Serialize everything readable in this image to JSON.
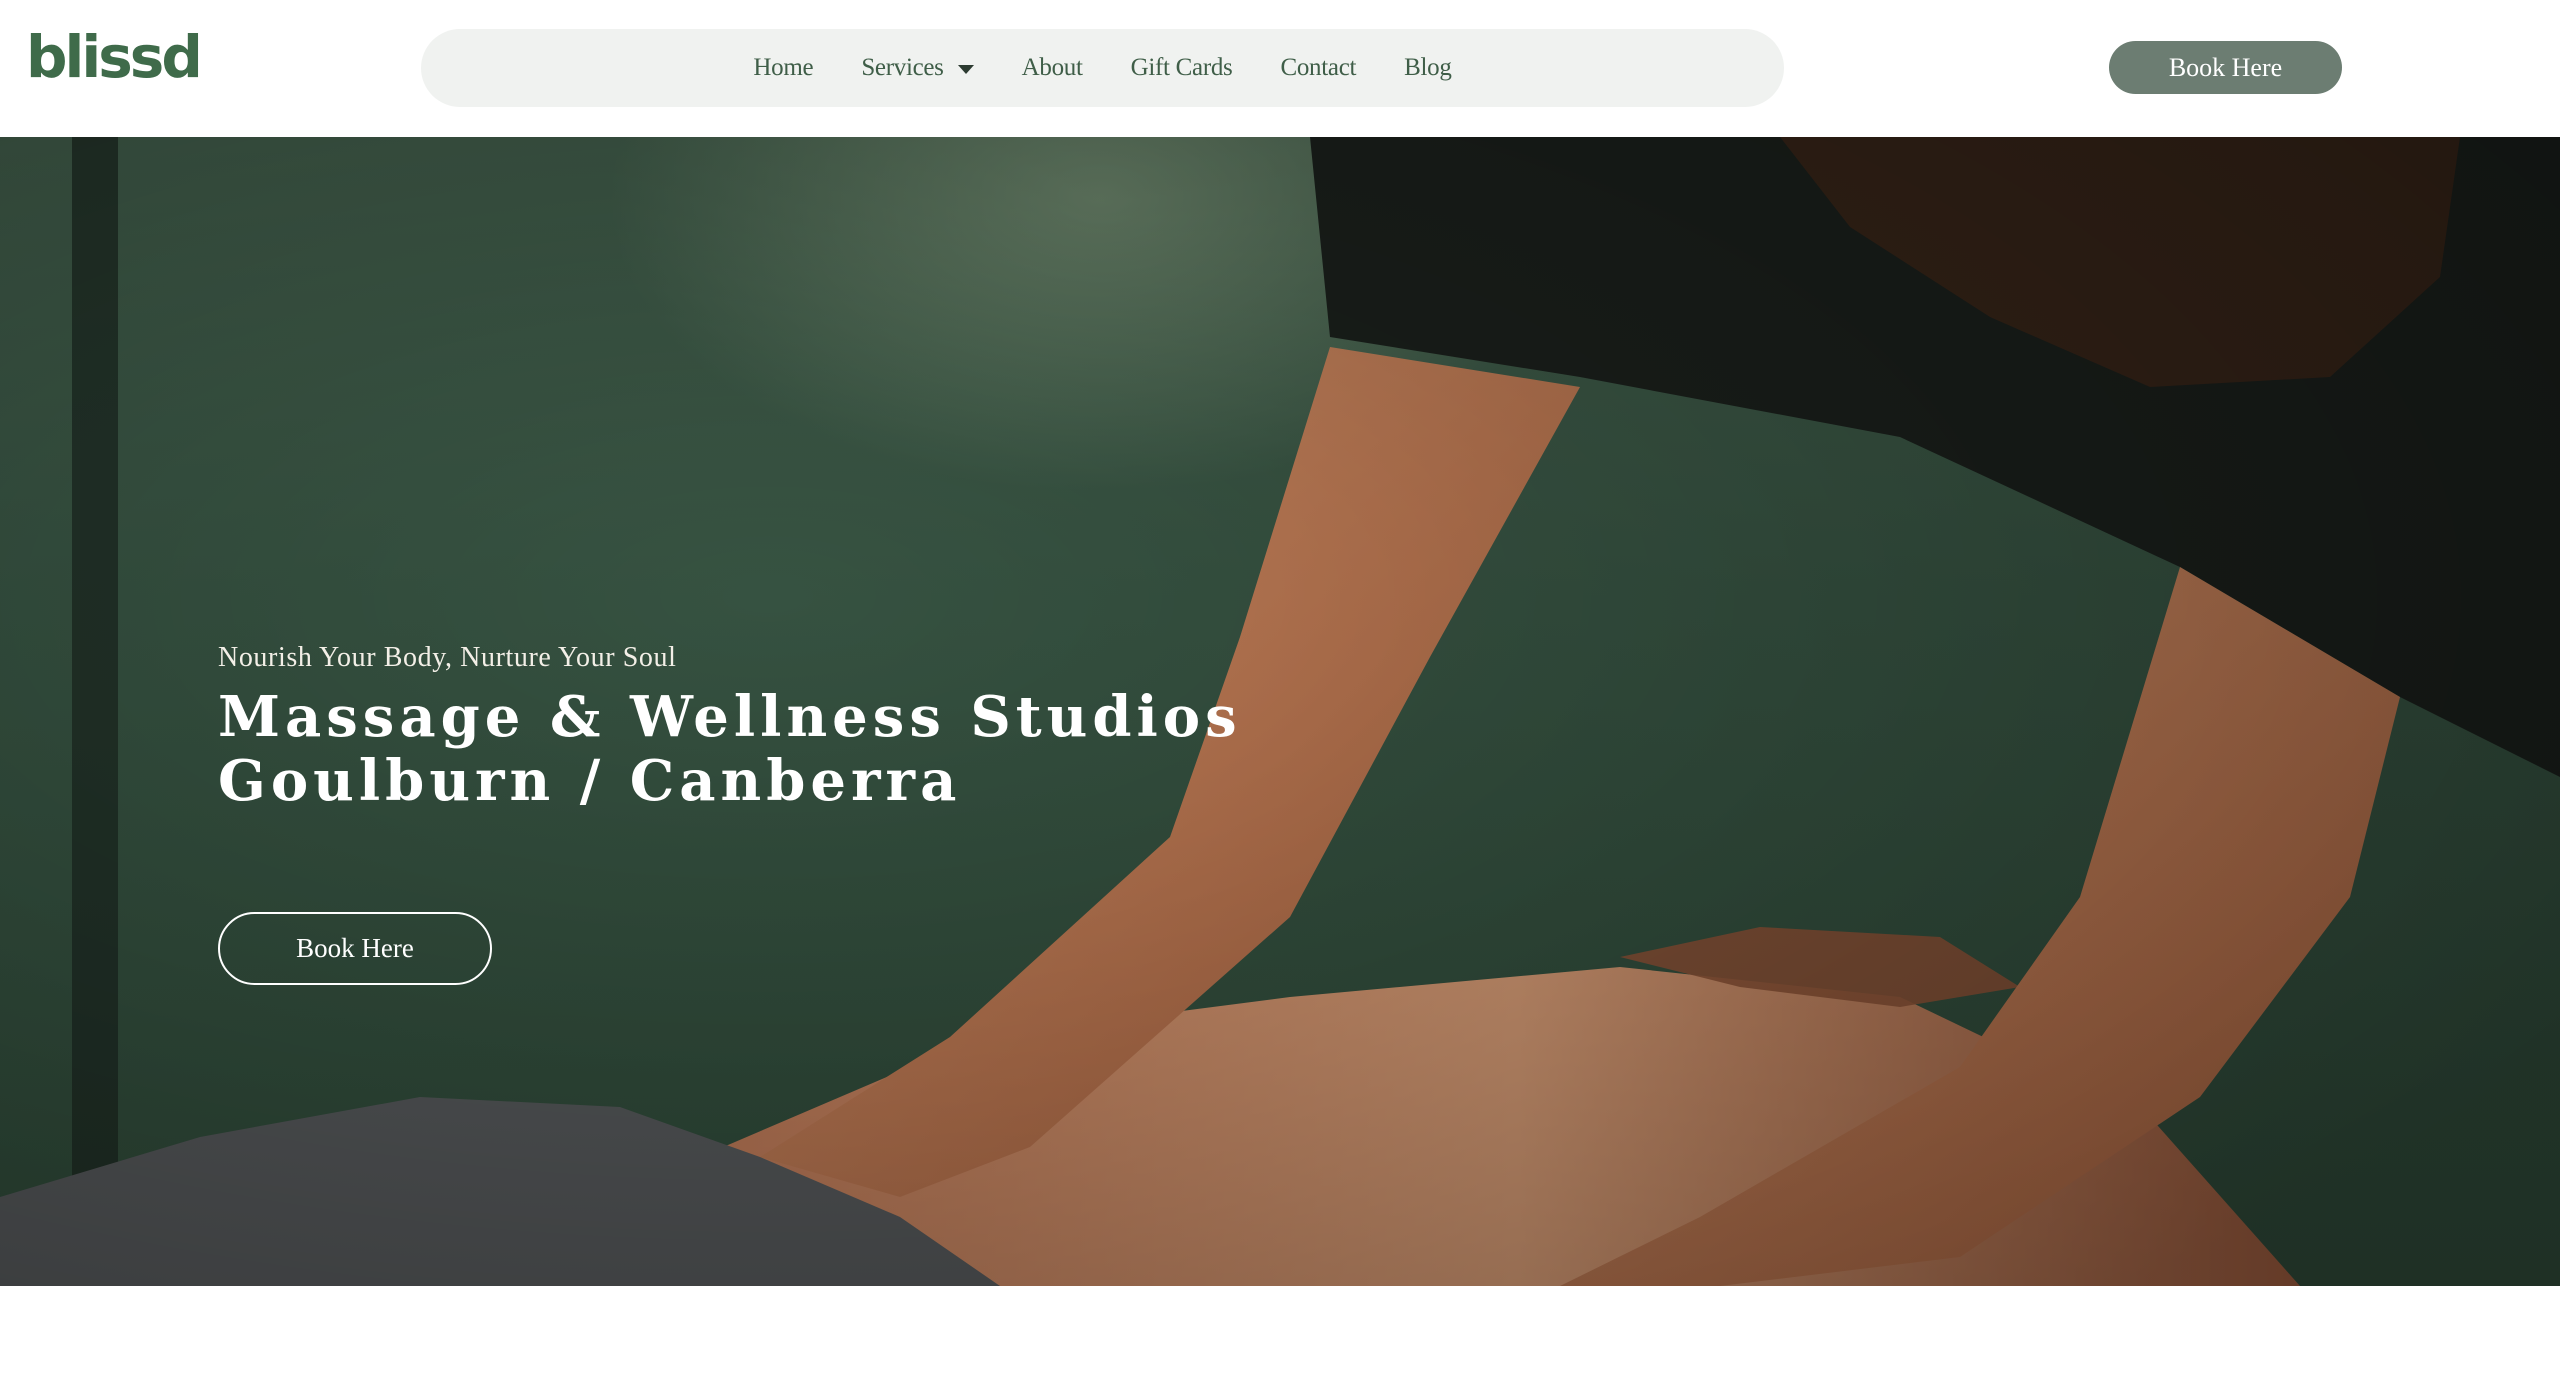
{
  "header": {
    "logo": "blissd",
    "nav": [
      {
        "label": "Home"
      },
      {
        "label": "Services",
        "has_dropdown": true
      },
      {
        "label": "About"
      },
      {
        "label": "Gift Cards"
      },
      {
        "label": "Contact"
      },
      {
        "label": "Blog"
      }
    ],
    "book_button": "Book Here"
  },
  "hero": {
    "subtitle": "Nourish Your Body, Nurture Your Soul",
    "title_line1": "Massage & Wellness Studios",
    "title_line2": "Goulburn / Canberra",
    "book_button": "Book Here"
  },
  "colors": {
    "brand_green": "#3f6b4a",
    "nav_pill_bg": "#f0f2f0",
    "top_button_bg": "#6c7d72",
    "hero_overlay": "#365241"
  }
}
